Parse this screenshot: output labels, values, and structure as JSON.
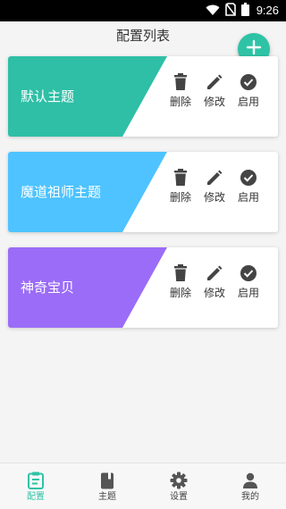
{
  "status_bar": {
    "time": "9:26"
  },
  "header": {
    "title": "配置列表"
  },
  "fab": {
    "icon": "plus-icon",
    "color": "#2fc3a6"
  },
  "configs": [
    {
      "name": "默认主题",
      "color": "#2fbfa6"
    },
    {
      "name": "魔道祖师主题",
      "color": "#4ec3ff"
    },
    {
      "name": "神奇宝贝",
      "color": "#9b6cf7"
    }
  ],
  "actions": {
    "delete_label": "删除",
    "edit_label": "修改",
    "enable_label": "启用"
  },
  "bottom_nav": {
    "active_color": "#2fc3a6",
    "items": [
      {
        "label": "配置",
        "icon": "config-list-icon",
        "active": true
      },
      {
        "label": "主题",
        "icon": "book-icon",
        "active": false
      },
      {
        "label": "设置",
        "icon": "gear-icon",
        "active": false
      },
      {
        "label": "我的",
        "icon": "person-icon",
        "active": false
      }
    ]
  }
}
